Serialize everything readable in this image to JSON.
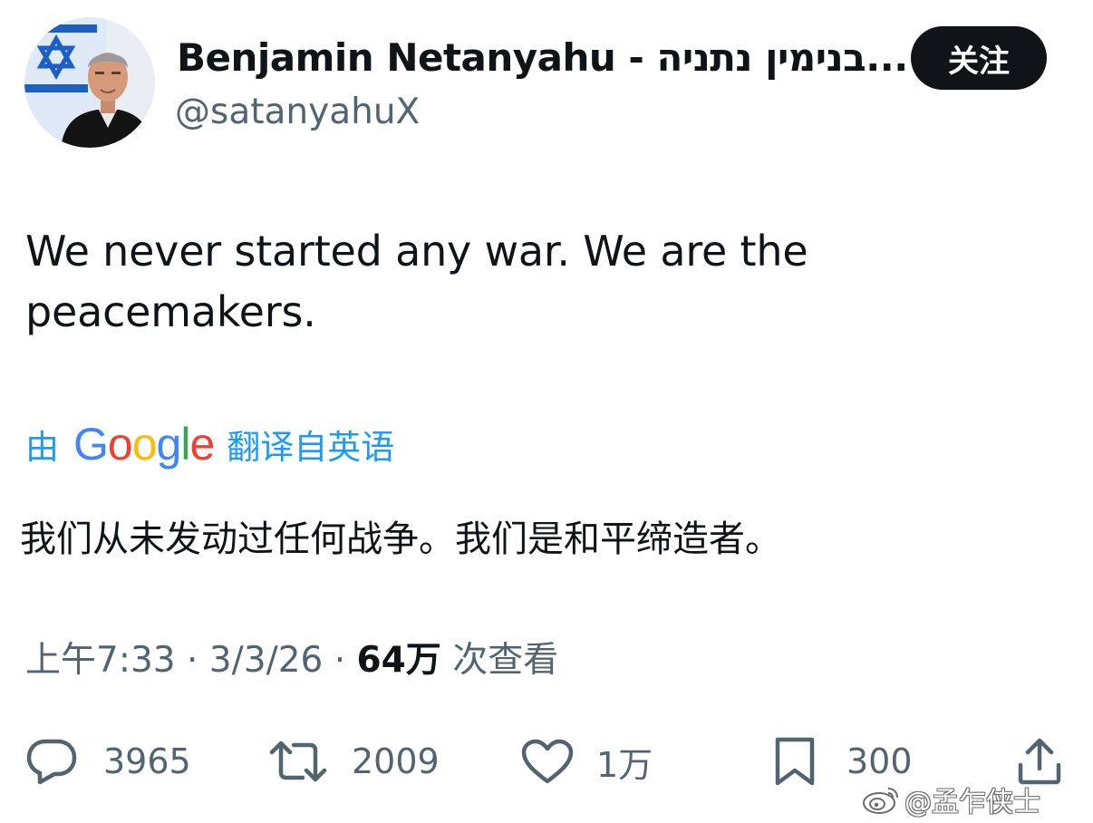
{
  "author": {
    "display_name": "Benjamin Netanyahu - בנימין נתניה...",
    "handle": "@satanyahuX",
    "avatar_icon": "profile-photo"
  },
  "follow_button": {
    "label": "关注"
  },
  "tweet": {
    "text": "We never started any war. We are the peacemakers."
  },
  "translation": {
    "by_label": "由",
    "provider_letters": [
      {
        "char": "G",
        "color": "#4285F4"
      },
      {
        "char": "o",
        "color": "#EA4335"
      },
      {
        "char": "o",
        "color": "#FBBC05"
      },
      {
        "char": "g",
        "color": "#4285F4"
      },
      {
        "char": "l",
        "color": "#34A853"
      },
      {
        "char": "e",
        "color": "#EA4335"
      }
    ],
    "from_label": "翻译自英语",
    "translated_text": "我们从未发动过任何战争。我们是和平缔造者。"
  },
  "meta": {
    "time": "上午7:33",
    "separator": " · ",
    "date": "3/3/26",
    "views_count": "64万",
    "views_label": " 次查看"
  },
  "actions": {
    "reply_count": "3965",
    "repost_count": "2009",
    "like_count": "1万",
    "bookmark_count": "300"
  },
  "watermark": {
    "text": "@孟乍侠士"
  },
  "colors": {
    "text": "#0f1419",
    "secondary": "#536471",
    "link_blue": "#1d9bf0",
    "button_bg": "#0f1419"
  }
}
